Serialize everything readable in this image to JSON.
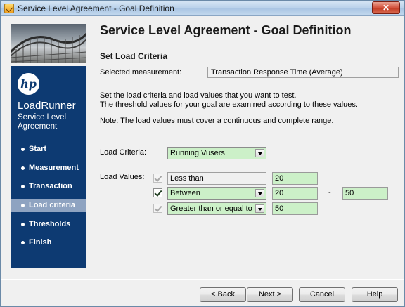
{
  "window": {
    "title": "Service Level Agreement - Goal Definition",
    "close_glyph": "✕"
  },
  "sidebar": {
    "logo": "hp",
    "product": "LoadRunner",
    "subtitle": "Service Level Agreement",
    "items": [
      {
        "label": "Start",
        "active": false
      },
      {
        "label": "Measurement",
        "active": false
      },
      {
        "label": "Transaction",
        "active": false
      },
      {
        "label": "Load criteria",
        "active": true
      },
      {
        "label": "Thresholds",
        "active": false
      },
      {
        "label": "Finish",
        "active": false
      }
    ]
  },
  "header": {
    "title": "Service Level Agreement - Goal Definition"
  },
  "section": {
    "title": "Set Load Criteria",
    "selected_measurement_label": "Selected measurement:",
    "selected_measurement_value": "Transaction Response Time (Average)",
    "desc_line1": "Set the load criteria and load values that you want to test.",
    "desc_line2": "The threshold values for your goal are examined according to these values.",
    "note": "Note: The load values must cover a continuous and complete range."
  },
  "load_criteria": {
    "label": "Load Criteria:",
    "value": "Running Vusers"
  },
  "load_values": {
    "label": "Load Values:",
    "rows": [
      {
        "checked": true,
        "enabled": false,
        "operator": "Less than",
        "value1": "20",
        "value2": ""
      },
      {
        "checked": true,
        "enabled": true,
        "operator": "Between",
        "value1": "20",
        "separator": "-",
        "value2": "50"
      },
      {
        "checked": true,
        "enabled": false,
        "operator": "Greater than or equal to",
        "value1": "50",
        "value2": ""
      }
    ]
  },
  "buttons": {
    "back": "< Back",
    "next": "Next >",
    "cancel": "Cancel",
    "help": "Help"
  },
  "colors": {
    "sidebar_bg": "#0d3a72",
    "field_green": "#ccf0c8",
    "active_nav": "#8ea3c1"
  }
}
